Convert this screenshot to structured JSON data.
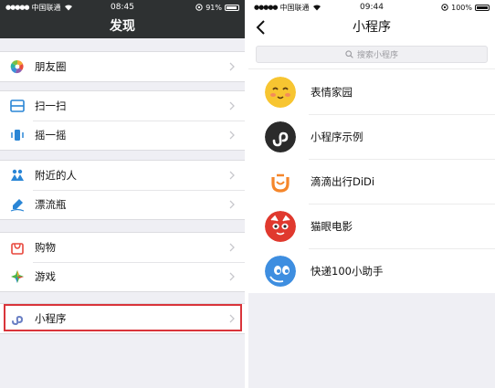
{
  "left": {
    "status": {
      "carrier": "中国联通",
      "time": "08:45",
      "battery": "91%",
      "battery_level": 0.91
    },
    "title": "发现",
    "groups": [
      [
        {
          "label": "朋友圈",
          "icon": "moments-icon"
        }
      ],
      [
        {
          "label": "扫一扫",
          "icon": "scan-icon"
        },
        {
          "label": "摇一摇",
          "icon": "shake-icon"
        }
      ],
      [
        {
          "label": "附近的人",
          "icon": "people-nearby-icon"
        },
        {
          "label": "漂流瓶",
          "icon": "drift-bottle-icon"
        }
      ],
      [
        {
          "label": "购物",
          "icon": "shopping-icon"
        },
        {
          "label": "游戏",
          "icon": "games-icon"
        }
      ],
      [
        {
          "label": "小程序",
          "icon": "mini-program-icon",
          "highlighted": true
        }
      ]
    ]
  },
  "right": {
    "status": {
      "carrier": "中国联通",
      "time": "09:44",
      "battery": "100%",
      "battery_level": 1.0
    },
    "title": "小程序",
    "search": {
      "placeholder": "搜索小程序"
    },
    "apps": [
      {
        "name": "表情家园",
        "icon": "emoji-face-icon"
      },
      {
        "name": "小程序示例",
        "icon": "mini-program-logo-icon"
      },
      {
        "name": "滴滴出行DiDi",
        "icon": "didi-icon"
      },
      {
        "name": "猫眼电影",
        "icon": "cat-eye-icon"
      },
      {
        "name": "快递100小助手",
        "icon": "kuaidi-icon"
      }
    ]
  },
  "colors": {
    "dark_bar": "#2e3132",
    "highlight": "#d9343a",
    "background": "#efeff4"
  }
}
